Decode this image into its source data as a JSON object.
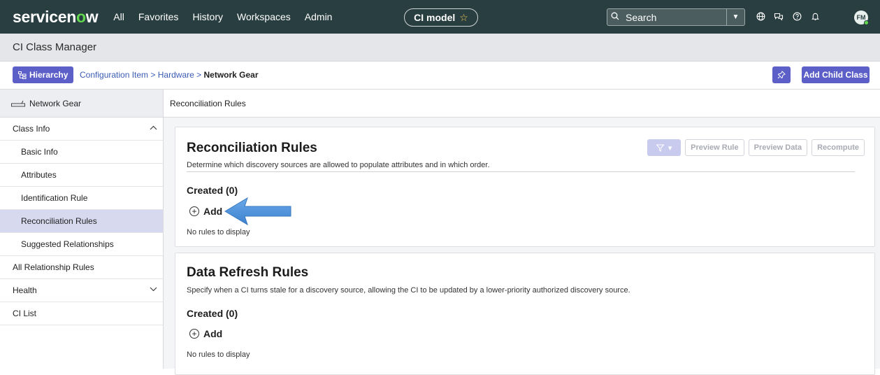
{
  "nav": {
    "logo": "servicen",
    "logo_o": "o",
    "logo_end": "w",
    "links": [
      "All",
      "Favorites",
      "History",
      "Workspaces",
      "Admin"
    ],
    "context_pill": "CI model",
    "search_placeholder": "Search",
    "avatar_initials": "FM",
    "icons": [
      "globe-icon",
      "chat-icon",
      "help-icon",
      "bell-icon"
    ]
  },
  "title": "CI Class Manager",
  "toolbar": {
    "hierarchy_label": "Hierarchy",
    "breadcrumb": [
      "Configuration Item",
      "Hardware",
      "Network Gear"
    ],
    "separator": ">",
    "add_child_label": "Add Child Class"
  },
  "sidebar": {
    "header": "Network Gear",
    "items": [
      {
        "label": "Class Info",
        "expanded": true
      },
      {
        "label": "Basic Info"
      },
      {
        "label": "Attributes"
      },
      {
        "label": "Identification Rule"
      },
      {
        "label": "Reconciliation Rules",
        "active": true
      },
      {
        "label": "Suggested Relationships"
      },
      {
        "label": "All Relationship Rules"
      },
      {
        "label": "Health",
        "expanded": false
      },
      {
        "label": "CI List"
      }
    ]
  },
  "main": {
    "crumb": "Reconciliation Rules",
    "recon": {
      "title": "Reconciliation Rules",
      "description": "Determine which discovery sources are allowed to populate attributes and in which order.",
      "created": "Created (0)",
      "add_label": "Add",
      "empty": "No rules to display",
      "actions": [
        "Preview Rule",
        "Preview Data",
        "Recompute"
      ]
    },
    "refresh": {
      "title": "Data Refresh Rules",
      "description": "Specify when a CI turns stale for a discovery source, allowing the CI to be updated by a lower-priority authorized discovery source.",
      "created": "Created (0)",
      "add_label": "Add",
      "empty": "No rules to display"
    }
  },
  "colors": {
    "nav_bg": "#293e40",
    "accent": "#5b5fc7",
    "active_item": "#d7d9ee",
    "arrow": "#4a90d9"
  }
}
